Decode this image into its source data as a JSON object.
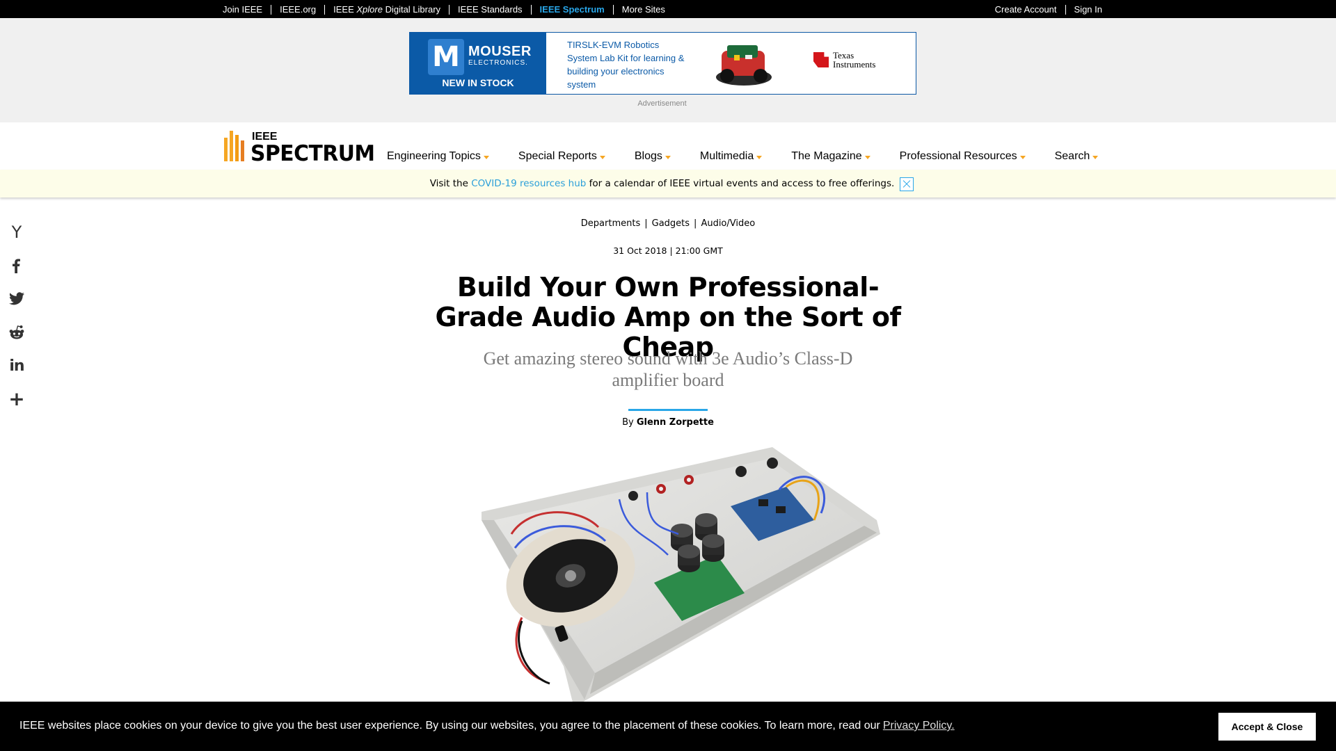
{
  "topbar": {
    "left_links": [
      {
        "label": "Join IEEE"
      },
      {
        "label": "IEEE.org"
      },
      {
        "label_prefix": "IEEE ",
        "label_em": "Xplore",
        "label_suffix": " Digital Library"
      },
      {
        "label": "IEEE Standards"
      },
      {
        "label": "IEEE Spectrum"
      },
      {
        "label": "More Sites"
      }
    ],
    "right_links": [
      {
        "label": "Create Account"
      },
      {
        "label": "Sign In"
      }
    ]
  },
  "ad": {
    "logo_letter": "M",
    "brand": "MOUSER",
    "brand_sub": "ELECTRONICS.",
    "badge": "NEW IN STOCK",
    "copy": "TIRSLK-EVM Robotics System Lab Kit for learning & building your electronics system",
    "partner_line1": "Texas",
    "partner_line2": "Instruments",
    "label": "Advertisement"
  },
  "header": {
    "logo_ieee": "IEEE",
    "logo_spectrum": "SPECTRUM",
    "nav": [
      {
        "label": "Engineering Topics"
      },
      {
        "label": "Special Reports"
      },
      {
        "label": "Blogs"
      },
      {
        "label": "Multimedia"
      },
      {
        "label": "The Magazine"
      },
      {
        "label": "Professional Resources"
      },
      {
        "label": "Search"
      }
    ]
  },
  "notice": {
    "before": "Visit the ",
    "link": "COVID-19 resources hub",
    "after": " for a calendar of IEEE virtual events and access to free offerings."
  },
  "share": [
    {
      "icon": "hacker-news-icon",
      "glyph": "Y"
    },
    {
      "icon": "facebook-icon"
    },
    {
      "icon": "twitter-icon"
    },
    {
      "icon": "reddit-icon"
    },
    {
      "icon": "linkedin-icon",
      "glyph": "in"
    },
    {
      "icon": "more-share-icon",
      "glyph": "+"
    }
  ],
  "article": {
    "breadcrumbs": [
      "Departments",
      "Gadgets",
      "Audio/Video"
    ],
    "dateline": "31 Oct 2018 | 21:00 GMT",
    "headline": "Build Your Own Professional-Grade Audio Amp on the Sort of Cheap",
    "dek": "Get amazing stereo sound with 3e Audio’s Class-D amplifier board",
    "byline_prefix": "By ",
    "author": "Glenn Zorpette"
  },
  "cookie": {
    "text": "IEEE websites place cookies on your device to give you the best user experience. By using our websites, you agree to the placement of these cookies. To learn more, read our",
    "link": "Privacy Policy.",
    "button": "Accept & Close"
  },
  "colors": {
    "accent_blue": "#29a6e8",
    "spectrum_orange": "#f5a623",
    "mouser_blue": "#0b5aa7",
    "ti_red": "#d4161b"
  }
}
